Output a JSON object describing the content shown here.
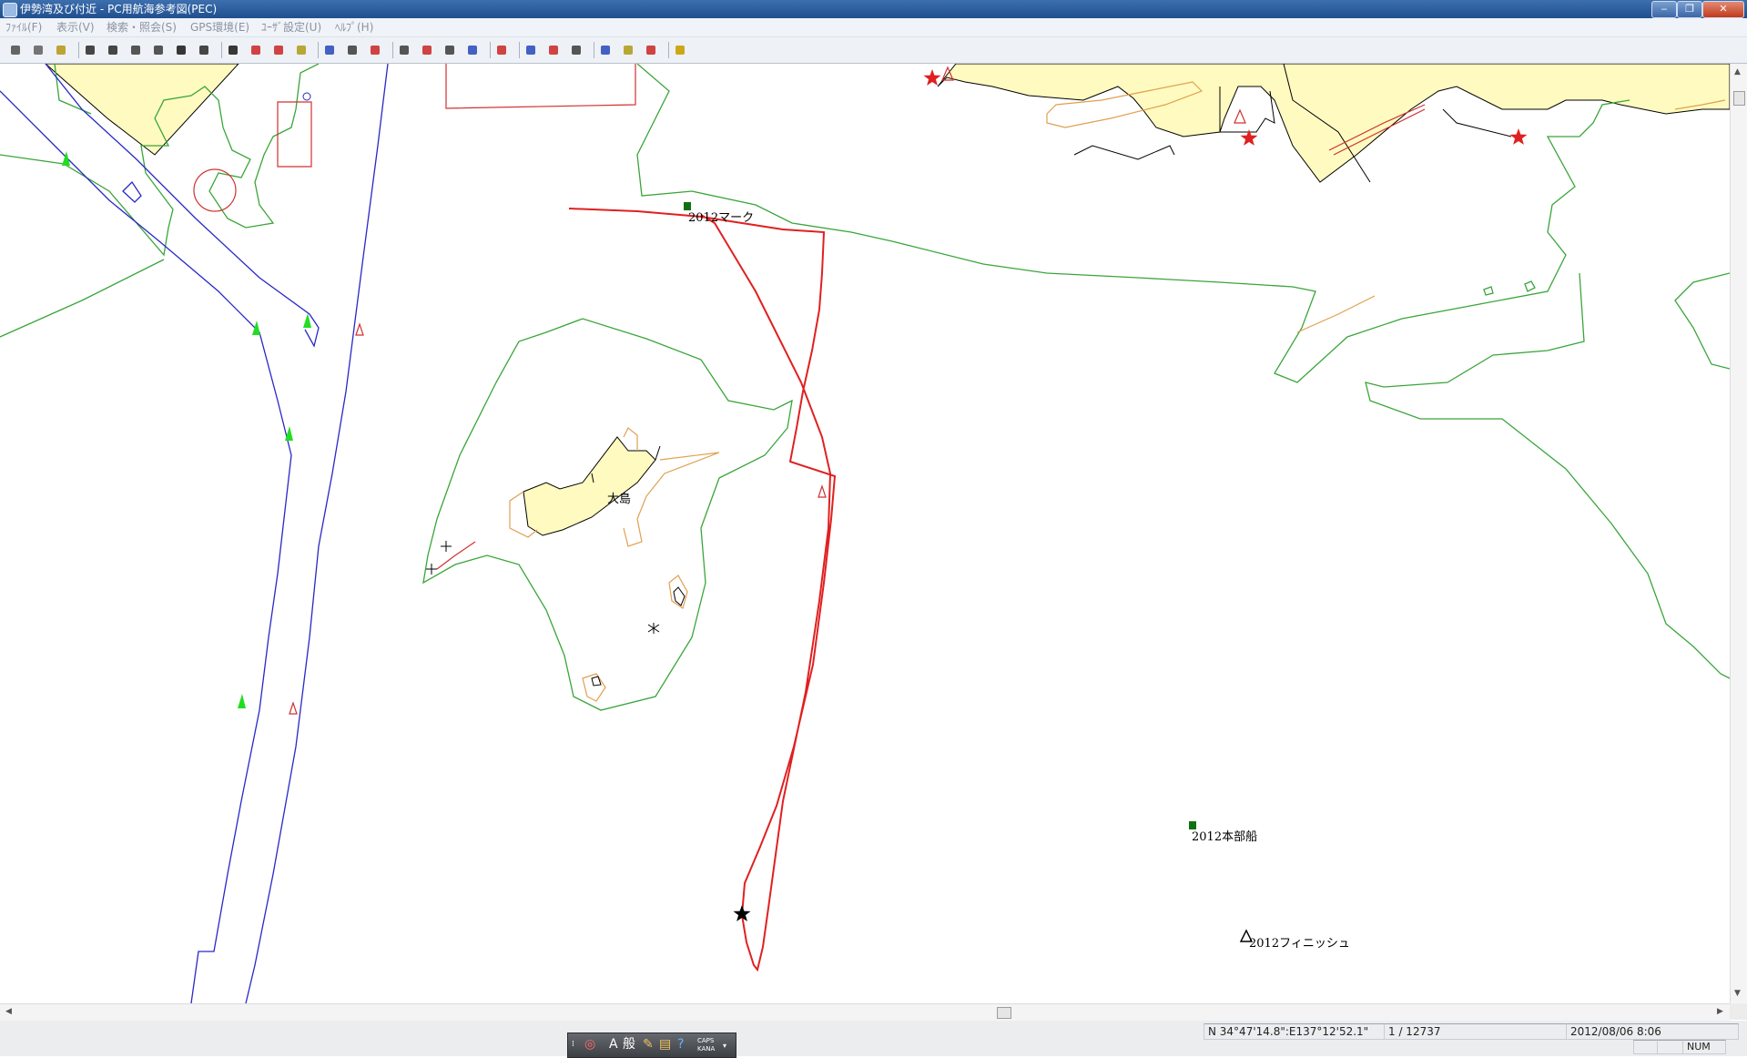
{
  "window": {
    "title": "伊勢湾及び付近 - PC用航海参考図(PEC)",
    "controls": [
      "‒",
      "❐",
      "✕"
    ]
  },
  "menu": {
    "items": [
      "ﾌｧｲﾙ(F)",
      "表示(V)",
      "検索・照会(S)",
      "GPS環境(E)",
      "ﾕｰｻﾞ設定(U)",
      "ﾍﾙﾌﾟ(H)"
    ]
  },
  "toolbar": {
    "icons": [
      "print-icon",
      "print-preview-icon",
      "save-icon",
      "zoom-in-icon",
      "zoom-out-icon",
      "fit-view-icon",
      "grid-icon",
      "measure-icon",
      "route-icon",
      "binoculars-icon",
      "buoy-icon",
      "ship-icon",
      "lighthouse-icon",
      "chart-icon",
      "table-icon",
      "mark-icon",
      "track-icon",
      "marker-edit-icon",
      "magnify-area-icon",
      "pencil-icon",
      "flag-search-icon",
      "gps-icon",
      "gps-mark-icon",
      "gps-view-icon",
      "pen-icon",
      "position-icon",
      "download-icon",
      "help-icon"
    ]
  },
  "map": {
    "labels": {
      "mark_2012": "2012マーク",
      "island": "大島",
      "honbusen_2012": "2012本部船",
      "finish_2012": "2012フィニッシュ"
    },
    "colors": {
      "track": "#e02020",
      "depth_contour": "#3aa53a",
      "channel": "#2828c8",
      "shallow": "#e0a050",
      "land": "#fffac0",
      "buoy_green": "#22dd22"
    }
  },
  "status": {
    "coordinates": "N 34°47'14.8\":E137°12'52.1\"",
    "scale": "1 / 12737",
    "datetime": "2012/08/06  8:06",
    "num": "NUM"
  },
  "ime": {
    "mode": "A",
    "input": "般",
    "caps": "CAPS",
    "kana": "KANA"
  }
}
